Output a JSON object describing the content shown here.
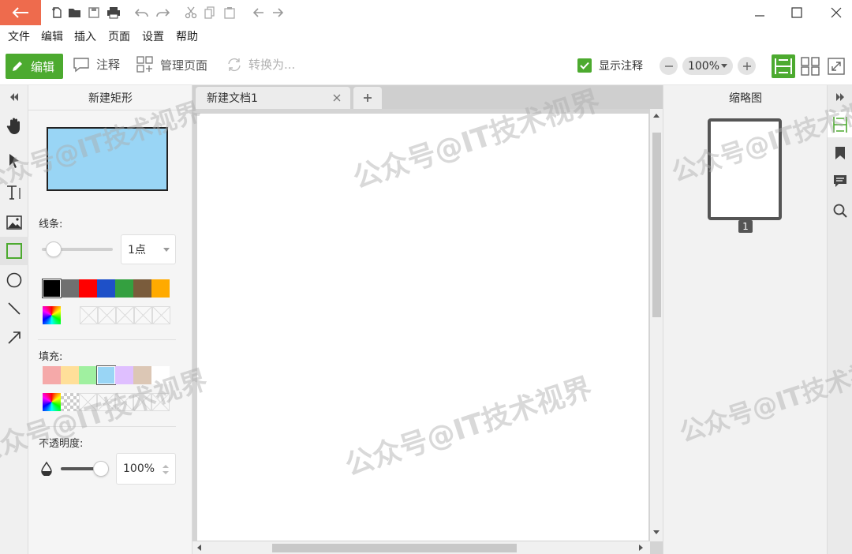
{
  "menu": [
    "文件",
    "编辑",
    "插入",
    "页面",
    "设置",
    "帮助"
  ],
  "toolbar": {
    "edit_label": "编辑",
    "annotate_label": "注释",
    "manage_pages_label": "管理页面",
    "convert_label": "转换为...",
    "show_annotations_label": "显示注释",
    "zoom_value": "100%"
  },
  "props": {
    "title": "新建矩形",
    "preview_fill": "#99d5f5",
    "line_label": "线条:",
    "line_width": "1点",
    "line_colors": [
      "#000000",
      "#707070",
      "#ff0000",
      "#1e50c8",
      "#34a040",
      "#7a5c3c",
      "#ffaa00"
    ],
    "fill_label": "填充:",
    "fill_colors": [
      "#f5a9a9",
      "#ffdf99",
      "#a0f0a0",
      "#99d5f5",
      "#dfbfff",
      "#dcc7b5",
      "#ffffff"
    ],
    "opacity_label": "不透明度:",
    "opacity_value": "100%",
    "opacity": 1.0
  },
  "document": {
    "tab_title": "新建文档1"
  },
  "thumbnails": {
    "title": "缩略图",
    "page_number": "1"
  },
  "watermark": "公众号@IT技术视界",
  "colors": {
    "accent": "#4caa2f",
    "back_button": "#ee6b4d"
  }
}
